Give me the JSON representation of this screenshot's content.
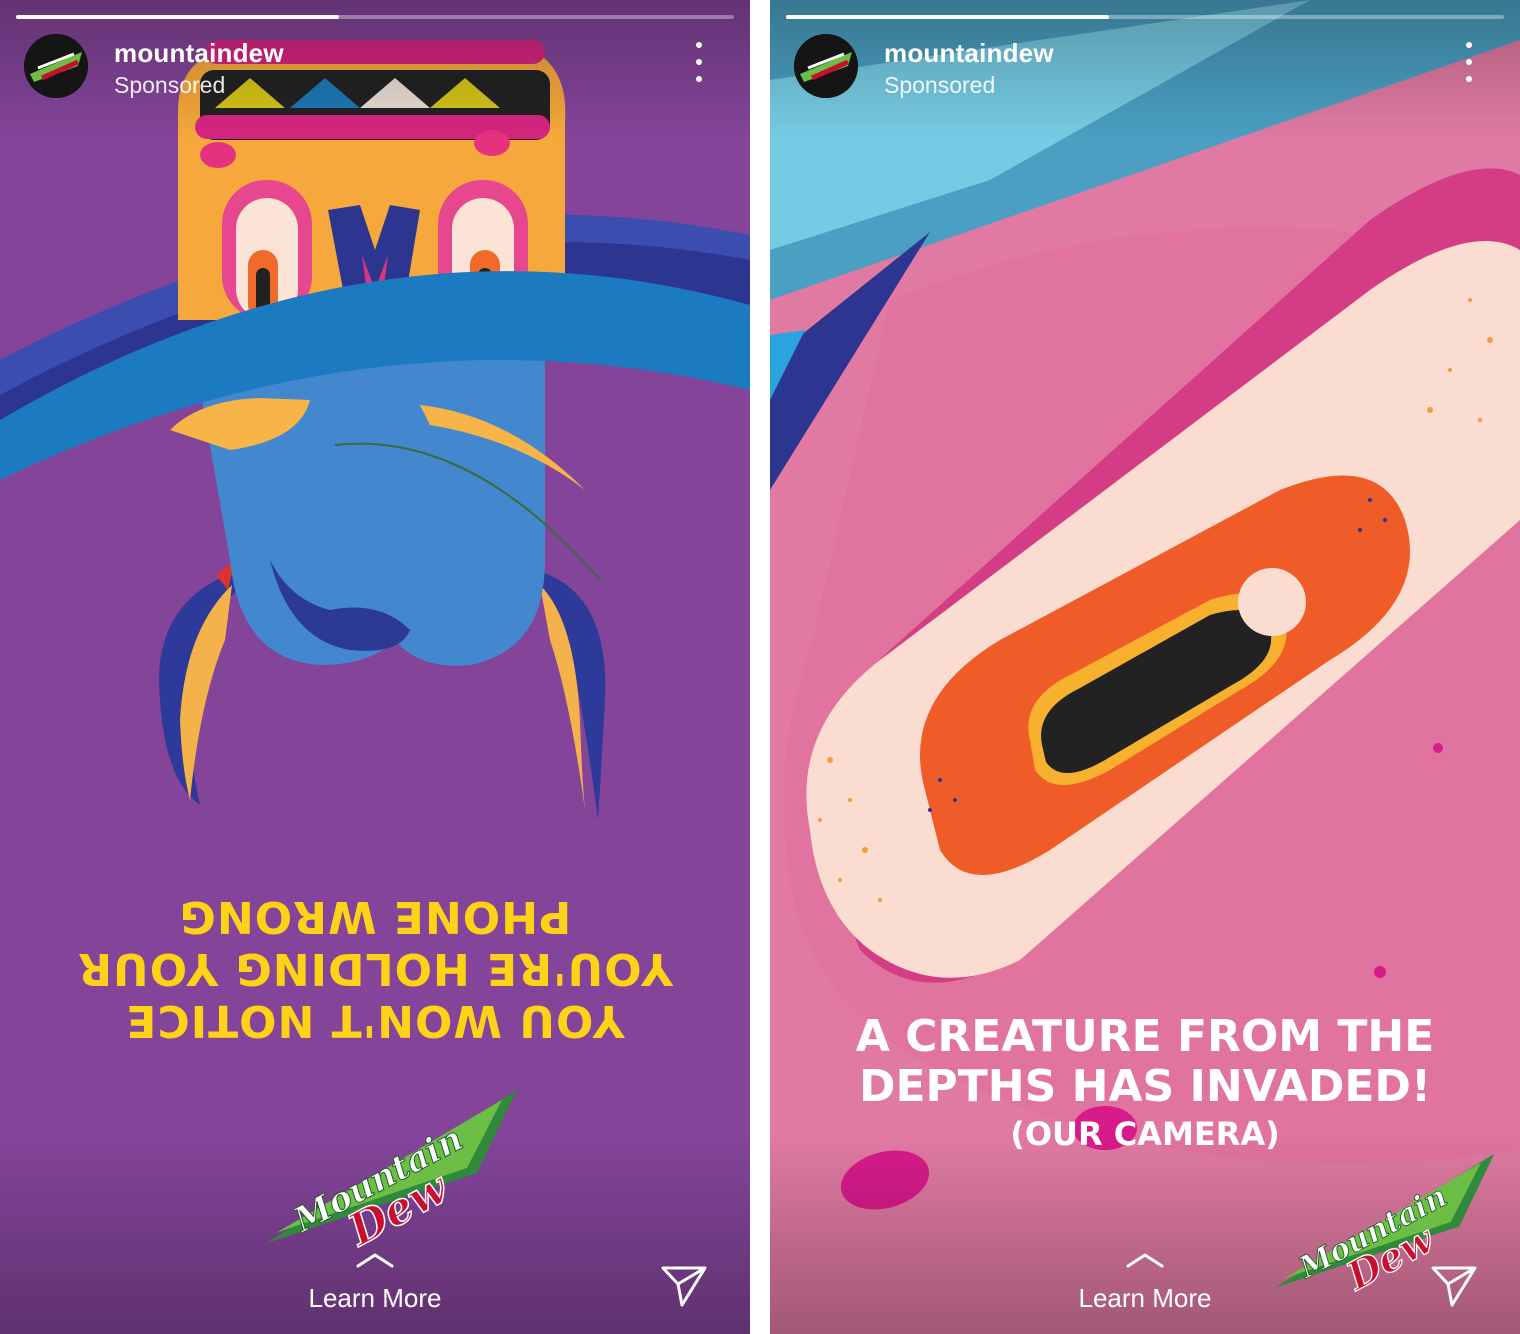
{
  "stories": [
    {
      "username": "mountaindew",
      "sponsored_label": "Sponsored",
      "progress": 0.45,
      "headline_lines": [
        "YOU WON'T NOTICE",
        "YOU'RE HOLDING YOUR",
        "PHONE WRONG"
      ],
      "brand_logo_text": [
        "Mountain",
        "Dew"
      ],
      "cta_label": "Learn More",
      "background": "#84449a"
    },
    {
      "username": "mountaindew",
      "sponsored_label": "Sponsored",
      "progress": 0.45,
      "caption_lines": [
        "A CREATURE FROM THE",
        "DEPTHS HAS INVADED!"
      ],
      "caption_sub": "(OUR CAMERA)",
      "brand_logo_text": [
        "Mountain",
        "Dew"
      ],
      "cta_label": "Learn More",
      "background": "#e07aa2"
    }
  ],
  "icons": {
    "more": "more-vertical-icon",
    "cta": "chevron-up-icon",
    "send": "send-icon"
  },
  "colors": {
    "brand_green": "#6cbe45",
    "brand_red": "#c8102e",
    "headline_yellow": "#fed315"
  }
}
